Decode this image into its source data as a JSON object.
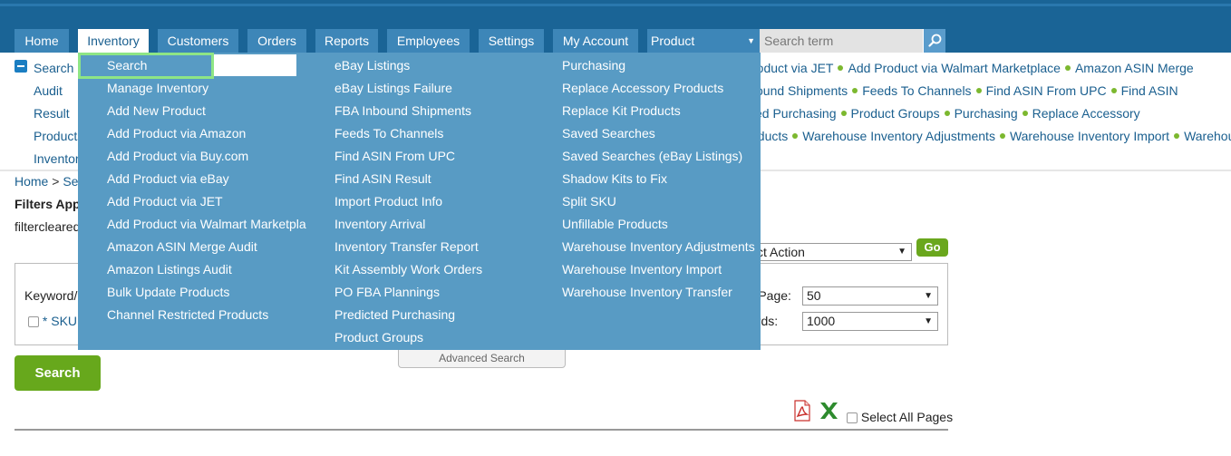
{
  "nav": {
    "tabs": [
      "Home",
      "Inventory",
      "Customers",
      "Orders",
      "Reports",
      "Employees",
      "Settings",
      "My Account"
    ],
    "product_select": "Product",
    "search_placeholder": "Search term"
  },
  "sublinks": {
    "left": [
      "Search",
      "Audit",
      "Result",
      "Products",
      "Inventor"
    ],
    "right_rows": [
      [
        "roduct via JET",
        "Add Product via Walmart Marketplace",
        "Amazon ASIN Merge"
      ],
      [
        "ound Shipments",
        "Feeds To Channels",
        "Find ASIN From UPC",
        "Find ASIN"
      ],
      [
        "ed Purchasing",
        "Product Groups",
        "Purchasing",
        "Replace Accessory"
      ],
      [
        "oducts",
        "Warehouse Inventory Adjustments",
        "Warehouse Inventory Import",
        "Warehouse"
      ]
    ]
  },
  "breadcrumb": {
    "home": "Home",
    "sep": ">",
    "current": "Sea"
  },
  "filters": {
    "title": "Filters App",
    "value": "filtercleared"
  },
  "form": {
    "keyword_label": "Keyword/L",
    "sku_label": "* SKU:",
    "action_select": "ct Action",
    "go_label": "Go",
    "per_page_label": "er Page:",
    "per_page_value": "50",
    "records_label": "cords:",
    "records_value": "1000",
    "advanced_search": "Advanced Search",
    "search_button": "Search",
    "select_all": "Select All Pages"
  },
  "dropdown": {
    "col1": [
      "Search",
      "Manage Inventory",
      "Add New Product",
      "Add Product via Amazon",
      "Add Product via Buy.com",
      "Add Product via eBay",
      "Add Product via JET",
      "Add Product via Walmart Marketplace",
      "Amazon ASIN Merge Audit",
      "Amazon Listings Audit",
      "Bulk Update Products",
      "Channel Restricted Products"
    ],
    "col2": [
      "eBay Listings",
      "eBay Listings Failure",
      "FBA Inbound Shipments",
      "Feeds To Channels",
      "Find ASIN From UPC",
      "Find ASIN Result",
      "Import Product Info",
      "Inventory Arrival",
      "Inventory Transfer Report",
      "Kit Assembly Work Orders",
      "PO FBA Plannings",
      "Predicted Purchasing",
      "Product Groups"
    ],
    "col3": [
      "Purchasing",
      "Replace Accessory Products",
      "Replace Kit Products",
      "Saved Searches",
      "Saved Searches (eBay Listings)",
      "Shadow Kits to Fix",
      "Split SKU",
      "Unfillable Products",
      "Warehouse Inventory Adjustments",
      "Warehouse Inventory Import",
      "Warehouse Inventory Transfer"
    ]
  },
  "colors": {
    "nav_bg": "#1a6496",
    "tab_bg": "#3d86b8",
    "dropdown_bg": "#589bc4",
    "accent_green": "#6aa71d",
    "highlight": "#8ee585"
  }
}
